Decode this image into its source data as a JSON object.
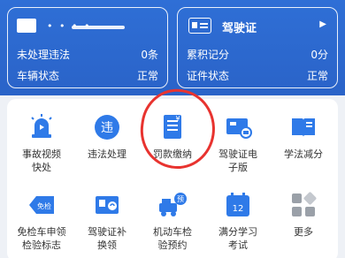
{
  "vehicle_card": {
    "plate_mask": "• • • •",
    "violations_label": "未处理违法",
    "violations_value": "0条",
    "status_label": "车辆状态",
    "status_value": "正常"
  },
  "license_card": {
    "title": "驾驶证",
    "arrow": "▶",
    "points_label": "累积记分",
    "points_value": "0分",
    "status_label": "证件状态",
    "status_value": "正常"
  },
  "services": [
    {
      "label": "事故视频\n快处",
      "icon": "siren-icon"
    },
    {
      "label": "违法处理",
      "icon": "violation-icon"
    },
    {
      "label": "罚款缴纳",
      "icon": "fine-payment-icon"
    },
    {
      "label": "驾驶证电\n子版",
      "icon": "e-license-icon"
    },
    {
      "label": "学法减分",
      "icon": "book-icon"
    },
    {
      "label": "免检车申领\n检验标志",
      "icon": "exempt-inspection-icon"
    },
    {
      "label": "驾驶证补\n换领",
      "icon": "license-renew-icon"
    },
    {
      "label": "机动车检\n验预约",
      "icon": "vehicle-inspection-icon"
    },
    {
      "label": "满分学习\n考试",
      "icon": "calendar-icon"
    },
    {
      "label": "更多",
      "icon": "more-icon"
    }
  ],
  "icon_badges": {
    "violation": "违",
    "fine": "¥",
    "exempt": "免检",
    "inspection": "预",
    "calendar_day": "12"
  },
  "colors": {
    "brand": "#2f6fd6",
    "icon_blue": "#2f7ae8",
    "highlight": "#e8332f"
  }
}
